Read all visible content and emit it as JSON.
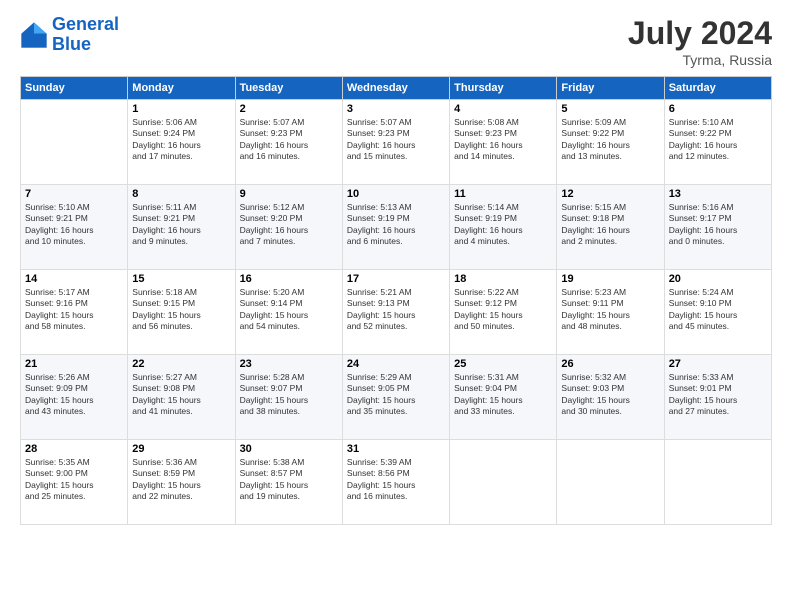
{
  "header": {
    "logo_line1": "General",
    "logo_line2": "Blue",
    "month": "July 2024",
    "location": "Tyrma, Russia"
  },
  "columns": [
    "Sunday",
    "Monday",
    "Tuesday",
    "Wednesday",
    "Thursday",
    "Friday",
    "Saturday"
  ],
  "weeks": [
    [
      {
        "day": "",
        "info": ""
      },
      {
        "day": "1",
        "info": "Sunrise: 5:06 AM\nSunset: 9:24 PM\nDaylight: 16 hours\nand 17 minutes."
      },
      {
        "day": "2",
        "info": "Sunrise: 5:07 AM\nSunset: 9:23 PM\nDaylight: 16 hours\nand 16 minutes."
      },
      {
        "day": "3",
        "info": "Sunrise: 5:07 AM\nSunset: 9:23 PM\nDaylight: 16 hours\nand 15 minutes."
      },
      {
        "day": "4",
        "info": "Sunrise: 5:08 AM\nSunset: 9:23 PM\nDaylight: 16 hours\nand 14 minutes."
      },
      {
        "day": "5",
        "info": "Sunrise: 5:09 AM\nSunset: 9:22 PM\nDaylight: 16 hours\nand 13 minutes."
      },
      {
        "day": "6",
        "info": "Sunrise: 5:10 AM\nSunset: 9:22 PM\nDaylight: 16 hours\nand 12 minutes."
      }
    ],
    [
      {
        "day": "7",
        "info": "Sunrise: 5:10 AM\nSunset: 9:21 PM\nDaylight: 16 hours\nand 10 minutes."
      },
      {
        "day": "8",
        "info": "Sunrise: 5:11 AM\nSunset: 9:21 PM\nDaylight: 16 hours\nand 9 minutes."
      },
      {
        "day": "9",
        "info": "Sunrise: 5:12 AM\nSunset: 9:20 PM\nDaylight: 16 hours\nand 7 minutes."
      },
      {
        "day": "10",
        "info": "Sunrise: 5:13 AM\nSunset: 9:19 PM\nDaylight: 16 hours\nand 6 minutes."
      },
      {
        "day": "11",
        "info": "Sunrise: 5:14 AM\nSunset: 9:19 PM\nDaylight: 16 hours\nand 4 minutes."
      },
      {
        "day": "12",
        "info": "Sunrise: 5:15 AM\nSunset: 9:18 PM\nDaylight: 16 hours\nand 2 minutes."
      },
      {
        "day": "13",
        "info": "Sunrise: 5:16 AM\nSunset: 9:17 PM\nDaylight: 16 hours\nand 0 minutes."
      }
    ],
    [
      {
        "day": "14",
        "info": "Sunrise: 5:17 AM\nSunset: 9:16 PM\nDaylight: 15 hours\nand 58 minutes."
      },
      {
        "day": "15",
        "info": "Sunrise: 5:18 AM\nSunset: 9:15 PM\nDaylight: 15 hours\nand 56 minutes."
      },
      {
        "day": "16",
        "info": "Sunrise: 5:20 AM\nSunset: 9:14 PM\nDaylight: 15 hours\nand 54 minutes."
      },
      {
        "day": "17",
        "info": "Sunrise: 5:21 AM\nSunset: 9:13 PM\nDaylight: 15 hours\nand 52 minutes."
      },
      {
        "day": "18",
        "info": "Sunrise: 5:22 AM\nSunset: 9:12 PM\nDaylight: 15 hours\nand 50 minutes."
      },
      {
        "day": "19",
        "info": "Sunrise: 5:23 AM\nSunset: 9:11 PM\nDaylight: 15 hours\nand 48 minutes."
      },
      {
        "day": "20",
        "info": "Sunrise: 5:24 AM\nSunset: 9:10 PM\nDaylight: 15 hours\nand 45 minutes."
      }
    ],
    [
      {
        "day": "21",
        "info": "Sunrise: 5:26 AM\nSunset: 9:09 PM\nDaylight: 15 hours\nand 43 minutes."
      },
      {
        "day": "22",
        "info": "Sunrise: 5:27 AM\nSunset: 9:08 PM\nDaylight: 15 hours\nand 41 minutes."
      },
      {
        "day": "23",
        "info": "Sunrise: 5:28 AM\nSunset: 9:07 PM\nDaylight: 15 hours\nand 38 minutes."
      },
      {
        "day": "24",
        "info": "Sunrise: 5:29 AM\nSunset: 9:05 PM\nDaylight: 15 hours\nand 35 minutes."
      },
      {
        "day": "25",
        "info": "Sunrise: 5:31 AM\nSunset: 9:04 PM\nDaylight: 15 hours\nand 33 minutes."
      },
      {
        "day": "26",
        "info": "Sunrise: 5:32 AM\nSunset: 9:03 PM\nDaylight: 15 hours\nand 30 minutes."
      },
      {
        "day": "27",
        "info": "Sunrise: 5:33 AM\nSunset: 9:01 PM\nDaylight: 15 hours\nand 27 minutes."
      }
    ],
    [
      {
        "day": "28",
        "info": "Sunrise: 5:35 AM\nSunset: 9:00 PM\nDaylight: 15 hours\nand 25 minutes."
      },
      {
        "day": "29",
        "info": "Sunrise: 5:36 AM\nSunset: 8:59 PM\nDaylight: 15 hours\nand 22 minutes."
      },
      {
        "day": "30",
        "info": "Sunrise: 5:38 AM\nSunset: 8:57 PM\nDaylight: 15 hours\nand 19 minutes."
      },
      {
        "day": "31",
        "info": "Sunrise: 5:39 AM\nSunset: 8:56 PM\nDaylight: 15 hours\nand 16 minutes."
      },
      {
        "day": "",
        "info": ""
      },
      {
        "day": "",
        "info": ""
      },
      {
        "day": "",
        "info": ""
      }
    ]
  ]
}
